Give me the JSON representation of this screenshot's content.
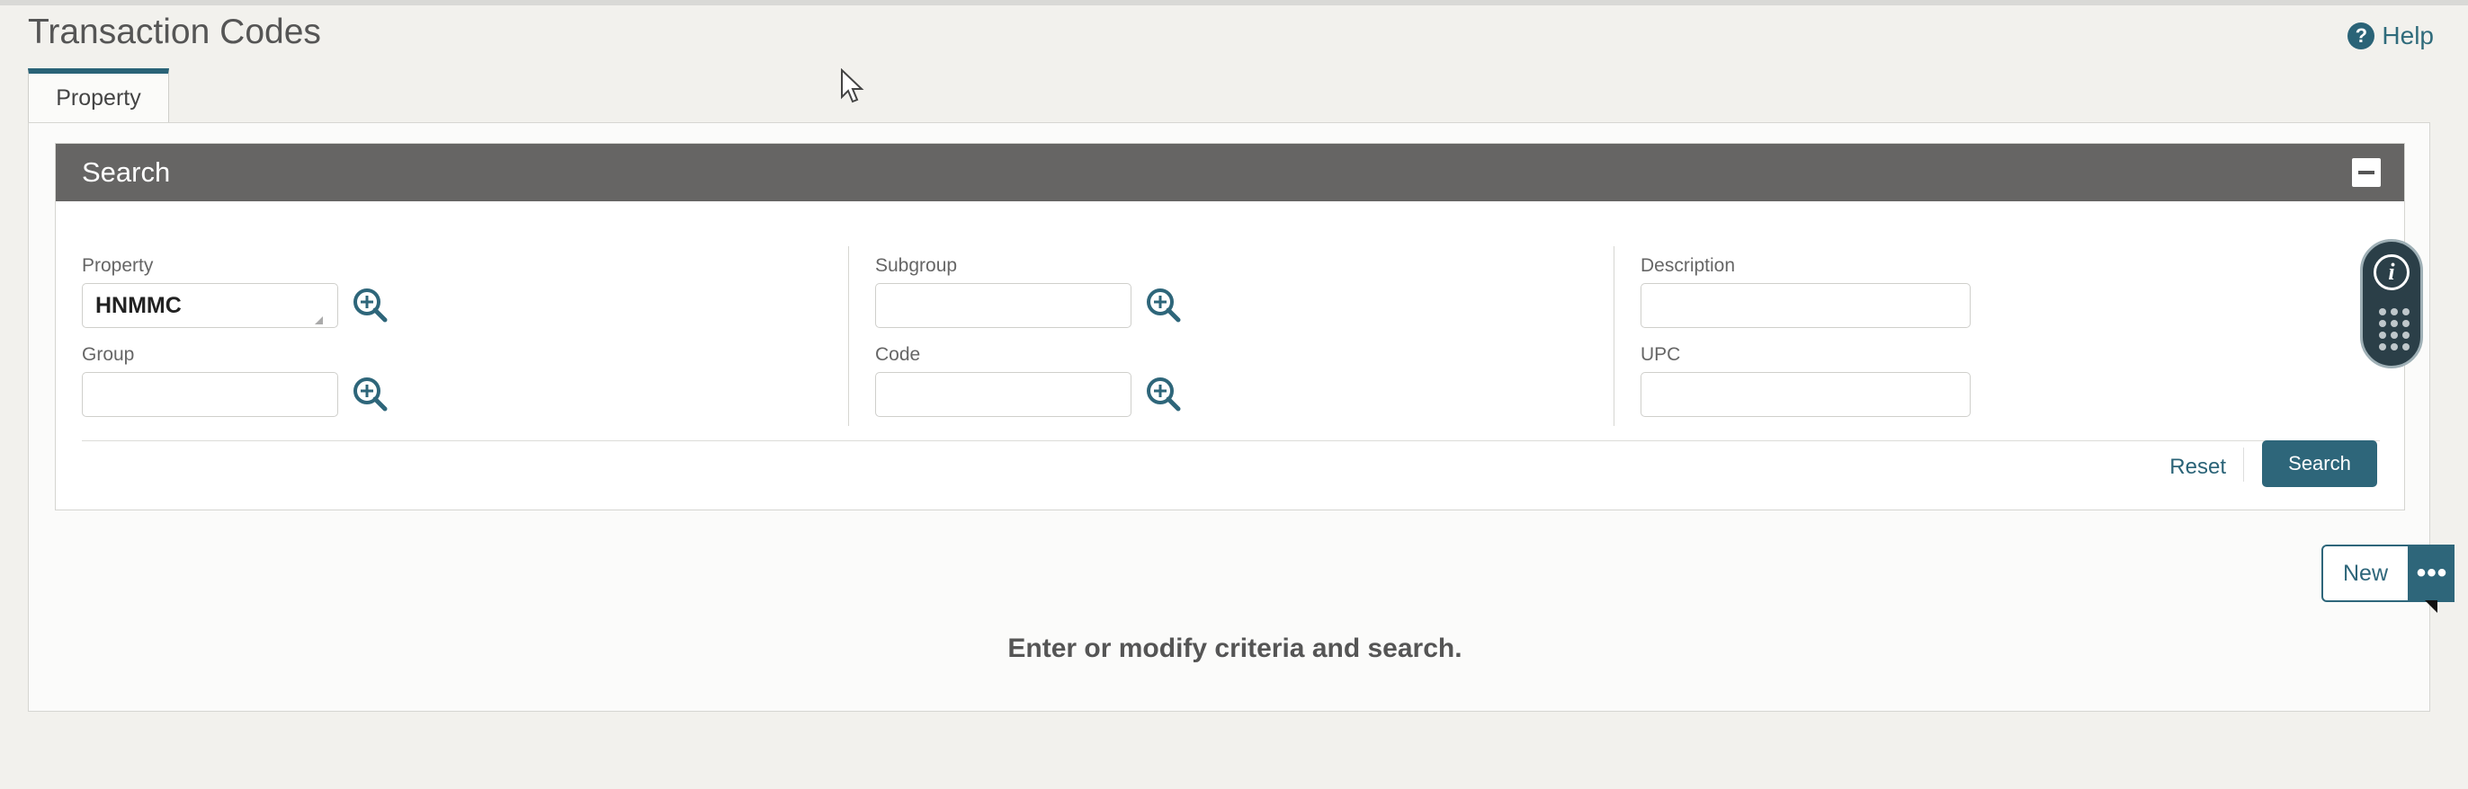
{
  "page": {
    "title": "Transaction Codes",
    "help_label": "Help"
  },
  "tabs": [
    {
      "label": "Property",
      "active": true
    }
  ],
  "search": {
    "header": "Search",
    "fields": {
      "property": {
        "label": "Property",
        "value": "HNMMC"
      },
      "group": {
        "label": "Group",
        "value": ""
      },
      "subgroup": {
        "label": "Subgroup",
        "value": ""
      },
      "code": {
        "label": "Code",
        "value": ""
      },
      "description": {
        "label": "Description",
        "value": ""
      },
      "upc": {
        "label": "UPC",
        "value": ""
      }
    },
    "reset_label": "Reset",
    "search_label": "Search"
  },
  "actions": {
    "new_label": "New",
    "more_label": "•••"
  },
  "results": {
    "empty_message": "Enter or modify criteria and search."
  },
  "colors": {
    "accent": "#2e667a",
    "header_bg": "#666564",
    "page_bg": "#f2f1ed"
  }
}
